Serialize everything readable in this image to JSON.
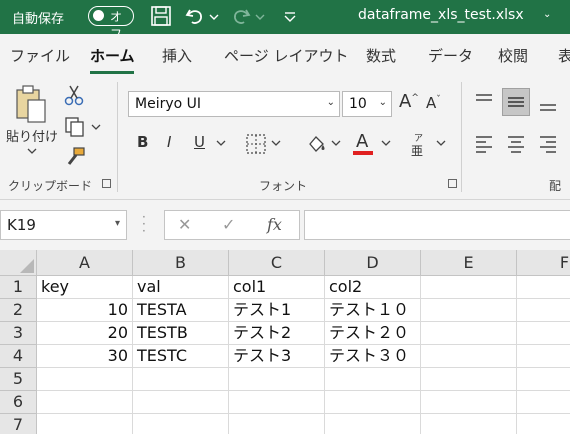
{
  "titlebar": {
    "autosave_label": "自動保存",
    "autosave_state": "オフ",
    "filename": "dataframe_xls_test.xlsx",
    "qat_icons": [
      "save-icon",
      "undo-icon",
      "redo-icon",
      "customize-qat-icon"
    ]
  },
  "tabs": [
    "ファイル",
    "ホーム",
    "挿入",
    "ページ レイアウト",
    "数式",
    "データ",
    "校閲",
    "表"
  ],
  "active_tab": "ホーム",
  "ribbon": {
    "clipboard": {
      "paste_label": "貼り付け",
      "group_label": "クリップボード"
    },
    "font": {
      "font_name": "Meiryo UI",
      "font_size": "10",
      "bold": "B",
      "italic": "I",
      "underline": "U",
      "font_color_letter": "A",
      "font_color": "#e02020",
      "phonetic_letter": "亜",
      "phonetic_small": "ア",
      "group_label": "フォント"
    },
    "alignment": {
      "group_label": "配"
    }
  },
  "formula_bar": {
    "name_box": "K19",
    "cancel": "✕",
    "enter": "✓",
    "fx": "fx",
    "value": ""
  },
  "grid": {
    "columns": [
      "A",
      "B",
      "C",
      "D",
      "E",
      "F"
    ],
    "rows": [
      "1",
      "2",
      "3",
      "4",
      "5",
      "6",
      "7"
    ],
    "cells": [
      [
        "key",
        "val",
        "col1",
        "col2",
        "",
        ""
      ],
      [
        "10",
        "TESTA",
        "テスト1",
        "テスト１０",
        "",
        ""
      ],
      [
        "20",
        "TESTB",
        "テスト2",
        "テスト２０",
        "",
        ""
      ],
      [
        "30",
        "TESTC",
        "テスト3",
        "テスト３０",
        "",
        ""
      ],
      [
        "",
        "",
        "",
        "",
        "",
        ""
      ],
      [
        "",
        "",
        "",
        "",
        "",
        ""
      ],
      [
        "",
        "",
        "",
        "",
        "",
        ""
      ]
    ]
  },
  "colors": {
    "excel_green": "#217346",
    "ribbon_bg": "#f3f3f3",
    "header_bg": "#e6e6e6"
  }
}
